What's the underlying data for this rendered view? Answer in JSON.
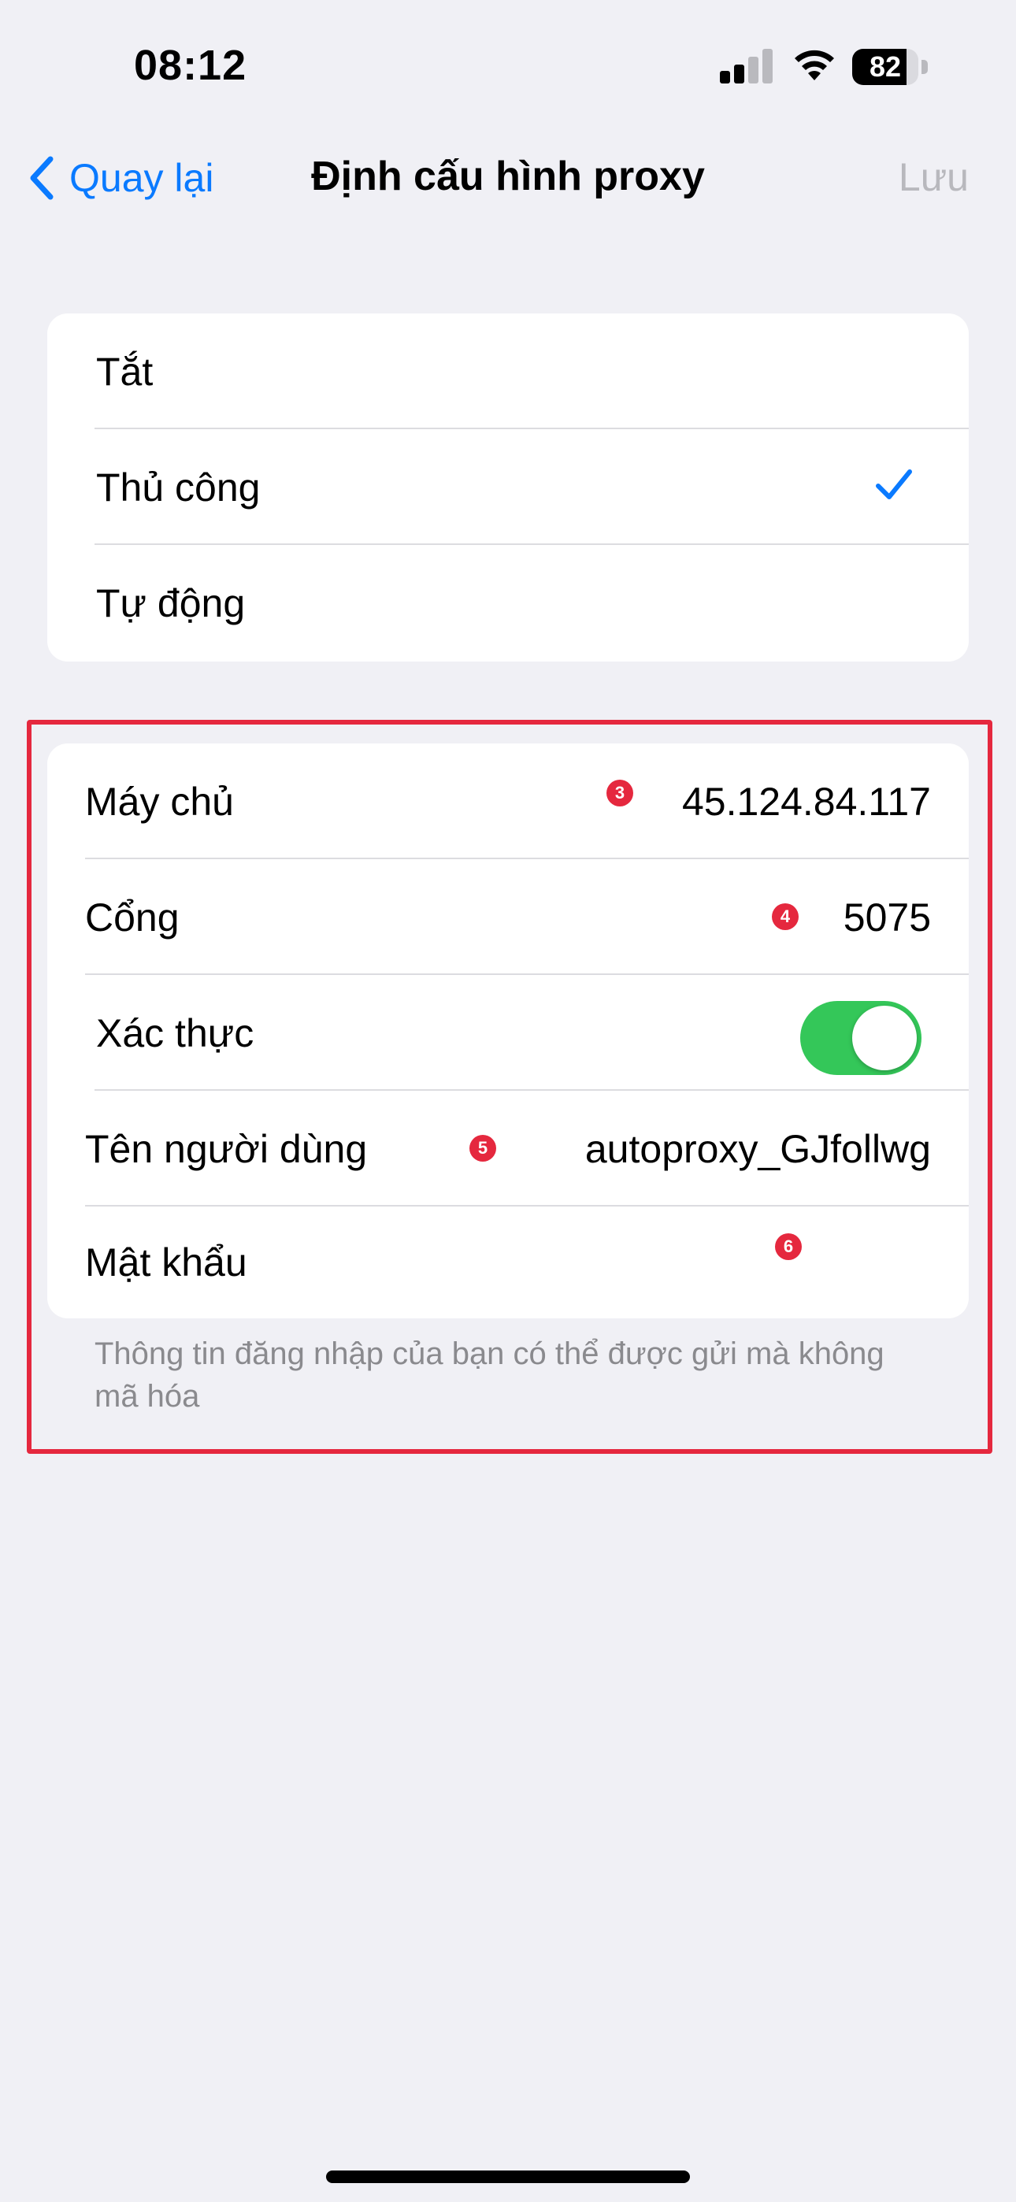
{
  "status_bar": {
    "time": "08:12",
    "battery_level": "82",
    "battery_fraction": 0.82,
    "icons": [
      "signal-icon",
      "wifi-icon",
      "battery-icon"
    ]
  },
  "nav": {
    "back_label": "Quay lại",
    "title": "Định cấu hình proxy",
    "save_label": "Lưu"
  },
  "mode_options": {
    "items": [
      {
        "label": "Tắt",
        "selected": false
      },
      {
        "label": "Thủ công",
        "selected": true
      },
      {
        "label": "Tự động",
        "selected": false
      }
    ]
  },
  "proxy_settings": {
    "server": {
      "label": "Máy chủ",
      "value": "45.124.84.117",
      "marker": "3"
    },
    "port": {
      "label": "Cổng",
      "value": "5075",
      "marker": "4"
    },
    "auth": {
      "label": "Xác thực",
      "enabled": true
    },
    "username": {
      "label": "Tên người dùng",
      "value": "autoproxy_GJfollwg",
      "marker": "5"
    },
    "password": {
      "label": "Mật khẩu",
      "value": "",
      "marker": "6"
    }
  },
  "footer_note": "Thông tin đăng nhập của bạn có thể được gửi mà không mã hóa",
  "colors": {
    "accent": "#0A7AFF",
    "toggle_on": "#34C759",
    "highlight": "#E5283E",
    "background": "#F0F0F5",
    "disabled_text": "#B8B8BD"
  }
}
